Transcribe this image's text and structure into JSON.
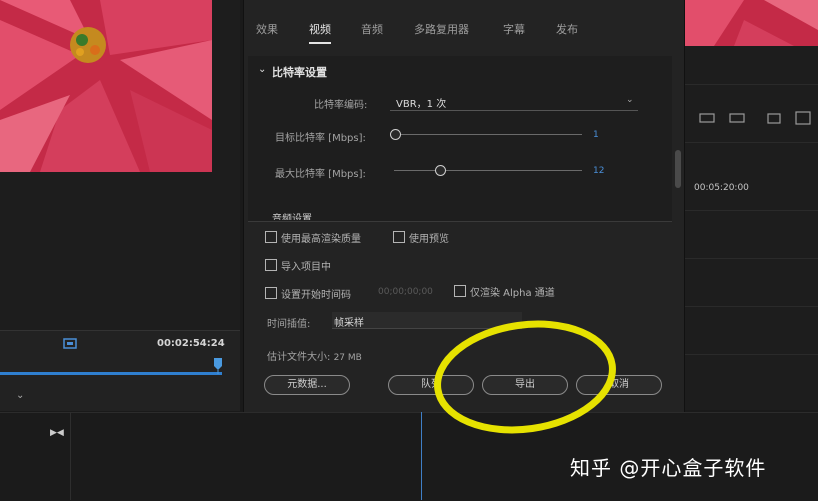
{
  "dialog": {
    "tabs": [
      {
        "label": "效果"
      },
      {
        "label": "视频"
      },
      {
        "label": "音频"
      },
      {
        "label": "多路复用器"
      },
      {
        "label": "字幕"
      },
      {
        "label": "发布"
      }
    ],
    "active_tab": "视频",
    "section_title": "比特率设置",
    "encoding_label": "比特率编码:",
    "encoding_value": "VBR，1 次",
    "target_bitrate_label": "目标比特率 [Mbps]:",
    "target_bitrate_value": "1",
    "target_bitrate_level": 0.0,
    "max_bitrate_label": "最大比特率 [Mbps]:",
    "max_bitrate_value": "12",
    "max_bitrate_level": 0.24,
    "next_section": "音频设置",
    "options": {
      "max_render_quality": "使用最高渲染质量",
      "use_previews": "使用预览",
      "import_into_project": "导入项目中",
      "set_start_timecode": "设置开始时间码",
      "start_timecode_value": "00;00;00;00",
      "render_alpha_only": "仅渲染 Alpha 通道"
    },
    "interpolation_label": "时间插值:",
    "interpolation_value": "帧采样",
    "filesize_label": "估计文件大小:",
    "filesize_value": "27 MB",
    "buttons": {
      "metadata": "元数据...",
      "queue": "队列",
      "export": "导出",
      "cancel": "取消"
    }
  },
  "source_monitor": {
    "timecode": "00:02:54:24"
  },
  "program_monitor": {
    "timecode": "00:05:20:00"
  },
  "watermark": "知乎 @开心盒子软件",
  "colors": {
    "accent": "#2f7fd0",
    "highlight": "#e6e200"
  }
}
